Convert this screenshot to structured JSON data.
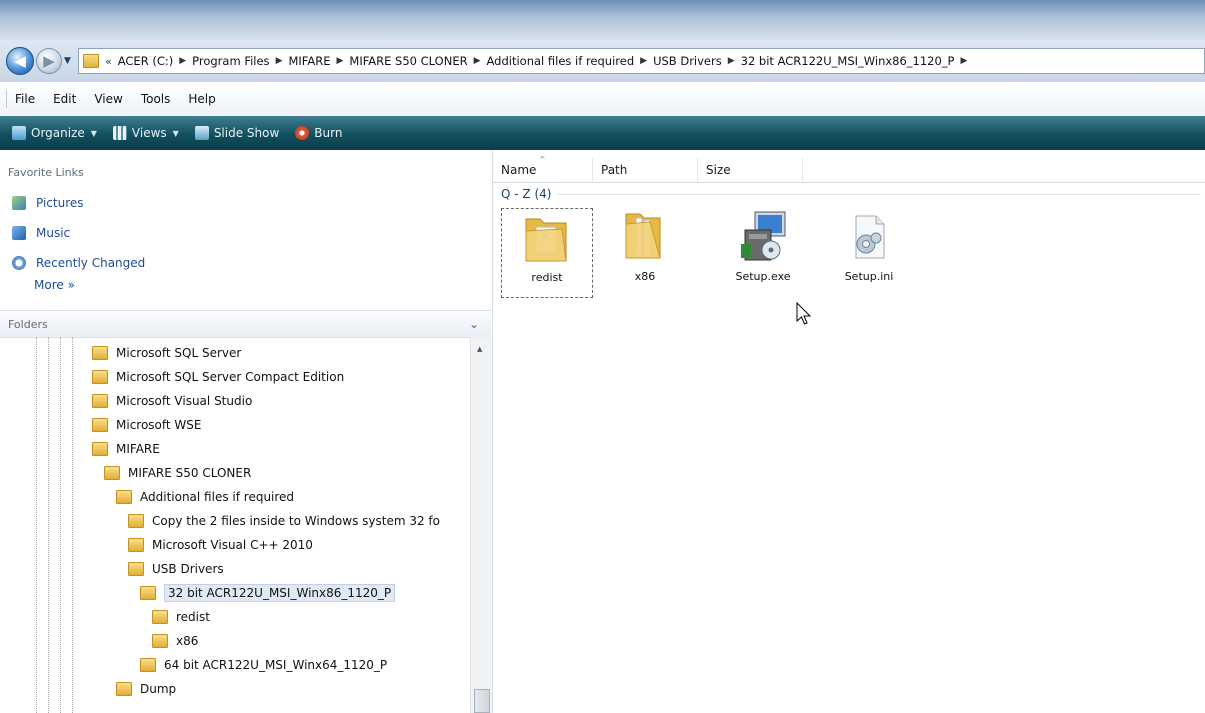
{
  "address": {
    "crumbs": [
      "ACER (C:)",
      "Program Files",
      "MIFARE",
      "MIFARE S50 CLONER",
      "Additional files if required",
      "USB Drivers",
      "32 bit ACR122U_MSI_Winx86_1120_P"
    ],
    "overflow_marker": "«"
  },
  "menu": {
    "items": [
      "File",
      "Edit",
      "View",
      "Tools",
      "Help"
    ]
  },
  "command_bar": {
    "items": [
      {
        "label": "Organize",
        "icon": "organize-icon",
        "has_dropdown": true
      },
      {
        "label": "Views",
        "icon": "views-icon",
        "has_dropdown": true
      },
      {
        "label": "Slide Show",
        "icon": "slideshow-icon",
        "has_dropdown": false
      },
      {
        "label": "Burn",
        "icon": "burn-icon",
        "has_dropdown": false
      }
    ]
  },
  "favorites": {
    "header": "Favorite Links",
    "items": [
      {
        "label": "Pictures",
        "icon": "pictures-icon"
      },
      {
        "label": "Music",
        "icon": "music-icon"
      },
      {
        "label": "Recently Changed",
        "icon": "recently-changed-icon"
      }
    ],
    "more": "More »"
  },
  "folders": {
    "header": "Folders",
    "tree": [
      {
        "label": "Microsoft SQL Server",
        "depth": 0
      },
      {
        "label": "Microsoft SQL Server Compact Edition",
        "depth": 0
      },
      {
        "label": "Microsoft Visual Studio",
        "depth": 0
      },
      {
        "label": "Microsoft WSE",
        "depth": 0
      },
      {
        "label": "MIFARE",
        "depth": 0
      },
      {
        "label": "MIFARE S50 CLONER",
        "depth": 1
      },
      {
        "label": "Additional files if required",
        "depth": 2
      },
      {
        "label": "Copy the 2 files inside to Windows system 32 fo",
        "depth": 3
      },
      {
        "label": "Microsoft Visual C++ 2010",
        "depth": 3
      },
      {
        "label": "USB Drivers",
        "depth": 3
      },
      {
        "label": "32 bit ACR122U_MSI_Winx86_1120_P",
        "depth": 4,
        "selected": true
      },
      {
        "label": "redist",
        "depth": 5
      },
      {
        "label": "x86",
        "depth": 5
      },
      {
        "label": "64 bit ACR122U_MSI_Winx64_1120_P",
        "depth": 4
      },
      {
        "label": "Dump",
        "depth": 2
      }
    ]
  },
  "content": {
    "columns": [
      "Name",
      "Path",
      "Size"
    ],
    "group": "Q - Z (4)",
    "files": [
      {
        "name": "redist",
        "type": "folder",
        "icon": "folder-icon"
      },
      {
        "name": "x86",
        "type": "folder",
        "icon": "folder-icon"
      },
      {
        "name": "Setup.exe",
        "type": "exe",
        "icon": "setup-exe-icon"
      },
      {
        "name": "Setup.ini",
        "type": "ini",
        "icon": "settings-file-icon"
      }
    ]
  },
  "colors": {
    "command_bar": "#12505f",
    "link": "#1f4b96",
    "folder": "#e1ae33"
  }
}
